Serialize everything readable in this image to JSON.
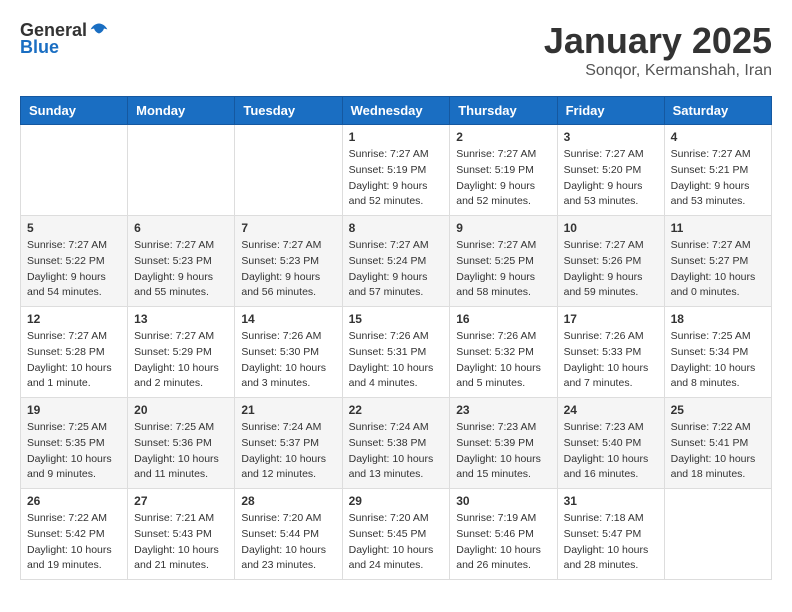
{
  "header": {
    "logo_general": "General",
    "logo_blue": "Blue",
    "month_title": "January 2025",
    "location": "Sonqor, Kermanshah, Iran"
  },
  "days_of_week": [
    "Sunday",
    "Monday",
    "Tuesday",
    "Wednesday",
    "Thursday",
    "Friday",
    "Saturday"
  ],
  "weeks": [
    [
      {
        "day": "",
        "info": ""
      },
      {
        "day": "",
        "info": ""
      },
      {
        "day": "",
        "info": ""
      },
      {
        "day": "1",
        "info": "Sunrise: 7:27 AM\nSunset: 5:19 PM\nDaylight: 9 hours\nand 52 minutes."
      },
      {
        "day": "2",
        "info": "Sunrise: 7:27 AM\nSunset: 5:19 PM\nDaylight: 9 hours\nand 52 minutes."
      },
      {
        "day": "3",
        "info": "Sunrise: 7:27 AM\nSunset: 5:20 PM\nDaylight: 9 hours\nand 53 minutes."
      },
      {
        "day": "4",
        "info": "Sunrise: 7:27 AM\nSunset: 5:21 PM\nDaylight: 9 hours\nand 53 minutes."
      }
    ],
    [
      {
        "day": "5",
        "info": "Sunrise: 7:27 AM\nSunset: 5:22 PM\nDaylight: 9 hours\nand 54 minutes."
      },
      {
        "day": "6",
        "info": "Sunrise: 7:27 AM\nSunset: 5:23 PM\nDaylight: 9 hours\nand 55 minutes."
      },
      {
        "day": "7",
        "info": "Sunrise: 7:27 AM\nSunset: 5:23 PM\nDaylight: 9 hours\nand 56 minutes."
      },
      {
        "day": "8",
        "info": "Sunrise: 7:27 AM\nSunset: 5:24 PM\nDaylight: 9 hours\nand 57 minutes."
      },
      {
        "day": "9",
        "info": "Sunrise: 7:27 AM\nSunset: 5:25 PM\nDaylight: 9 hours\nand 58 minutes."
      },
      {
        "day": "10",
        "info": "Sunrise: 7:27 AM\nSunset: 5:26 PM\nDaylight: 9 hours\nand 59 minutes."
      },
      {
        "day": "11",
        "info": "Sunrise: 7:27 AM\nSunset: 5:27 PM\nDaylight: 10 hours\nand 0 minutes."
      }
    ],
    [
      {
        "day": "12",
        "info": "Sunrise: 7:27 AM\nSunset: 5:28 PM\nDaylight: 10 hours\nand 1 minute."
      },
      {
        "day": "13",
        "info": "Sunrise: 7:27 AM\nSunset: 5:29 PM\nDaylight: 10 hours\nand 2 minutes."
      },
      {
        "day": "14",
        "info": "Sunrise: 7:26 AM\nSunset: 5:30 PM\nDaylight: 10 hours\nand 3 minutes."
      },
      {
        "day": "15",
        "info": "Sunrise: 7:26 AM\nSunset: 5:31 PM\nDaylight: 10 hours\nand 4 minutes."
      },
      {
        "day": "16",
        "info": "Sunrise: 7:26 AM\nSunset: 5:32 PM\nDaylight: 10 hours\nand 5 minutes."
      },
      {
        "day": "17",
        "info": "Sunrise: 7:26 AM\nSunset: 5:33 PM\nDaylight: 10 hours\nand 7 minutes."
      },
      {
        "day": "18",
        "info": "Sunrise: 7:25 AM\nSunset: 5:34 PM\nDaylight: 10 hours\nand 8 minutes."
      }
    ],
    [
      {
        "day": "19",
        "info": "Sunrise: 7:25 AM\nSunset: 5:35 PM\nDaylight: 10 hours\nand 9 minutes."
      },
      {
        "day": "20",
        "info": "Sunrise: 7:25 AM\nSunset: 5:36 PM\nDaylight: 10 hours\nand 11 minutes."
      },
      {
        "day": "21",
        "info": "Sunrise: 7:24 AM\nSunset: 5:37 PM\nDaylight: 10 hours\nand 12 minutes."
      },
      {
        "day": "22",
        "info": "Sunrise: 7:24 AM\nSunset: 5:38 PM\nDaylight: 10 hours\nand 13 minutes."
      },
      {
        "day": "23",
        "info": "Sunrise: 7:23 AM\nSunset: 5:39 PM\nDaylight: 10 hours\nand 15 minutes."
      },
      {
        "day": "24",
        "info": "Sunrise: 7:23 AM\nSunset: 5:40 PM\nDaylight: 10 hours\nand 16 minutes."
      },
      {
        "day": "25",
        "info": "Sunrise: 7:22 AM\nSunset: 5:41 PM\nDaylight: 10 hours\nand 18 minutes."
      }
    ],
    [
      {
        "day": "26",
        "info": "Sunrise: 7:22 AM\nSunset: 5:42 PM\nDaylight: 10 hours\nand 19 minutes."
      },
      {
        "day": "27",
        "info": "Sunrise: 7:21 AM\nSunset: 5:43 PM\nDaylight: 10 hours\nand 21 minutes."
      },
      {
        "day": "28",
        "info": "Sunrise: 7:20 AM\nSunset: 5:44 PM\nDaylight: 10 hours\nand 23 minutes."
      },
      {
        "day": "29",
        "info": "Sunrise: 7:20 AM\nSunset: 5:45 PM\nDaylight: 10 hours\nand 24 minutes."
      },
      {
        "day": "30",
        "info": "Sunrise: 7:19 AM\nSunset: 5:46 PM\nDaylight: 10 hours\nand 26 minutes."
      },
      {
        "day": "31",
        "info": "Sunrise: 7:18 AM\nSunset: 5:47 PM\nDaylight: 10 hours\nand 28 minutes."
      },
      {
        "day": "",
        "info": ""
      }
    ]
  ]
}
